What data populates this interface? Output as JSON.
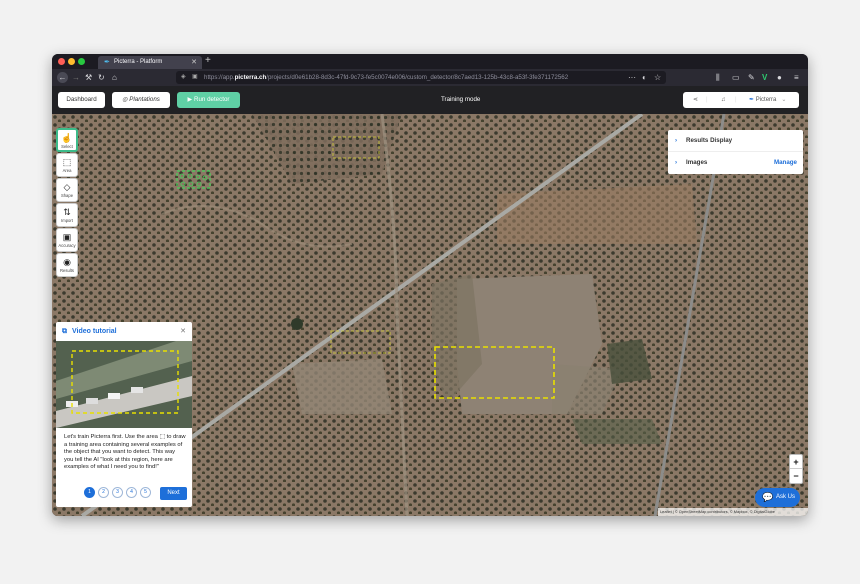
{
  "browser": {
    "tab_title": "Picterra - Platform",
    "url_prefix": "https://app.",
    "url_domain": "picterra.ch",
    "url_path": "/projects/d0e61b28-8d3c-47fd-9c73-fe5c0074e006/custom_detector/8c7aed13-125b-43c8-a53f-3fe371172562"
  },
  "appbar": {
    "dashboard_label": "Dashboard",
    "project_label": "Plantations",
    "run_label": "Run detector",
    "mode_label": "Training mode",
    "user_label": "Picterra"
  },
  "tools": [
    {
      "label": "Select",
      "icon": "hand-icon"
    },
    {
      "label": "Area",
      "icon": "area-icon"
    },
    {
      "label": "Shape",
      "icon": "shape-icon"
    },
    {
      "label": "Import",
      "icon": "import-icon"
    },
    {
      "label": "Accuracy",
      "icon": "accuracy-icon"
    },
    {
      "label": "Results",
      "icon": "eye-icon"
    }
  ],
  "panel": {
    "results_display": "Results Display",
    "images": "Images",
    "manage": "Manage"
  },
  "video": {
    "title": "Video tutorial",
    "text": "Let's train Picterra first. Use the area ⬚ to draw a training area containing several examples of the object that you want to detect. This way you tell the AI \"look at this region, here are examples of what I need you to find!\"",
    "pages": [
      "1",
      "2",
      "3",
      "4",
      "5"
    ],
    "current_page": 1,
    "next_label": "Next"
  },
  "zoom": {
    "in": "+",
    "out": "−"
  },
  "ask_label": "Ask Us",
  "attribution": "Leaflet | © OpenStreetMap contributors, © Mapbox, © DigitalGlobe",
  "colors": {
    "accent": "#1e6fd9",
    "green": "#5fd0a5",
    "training_box": "#e8e000"
  }
}
